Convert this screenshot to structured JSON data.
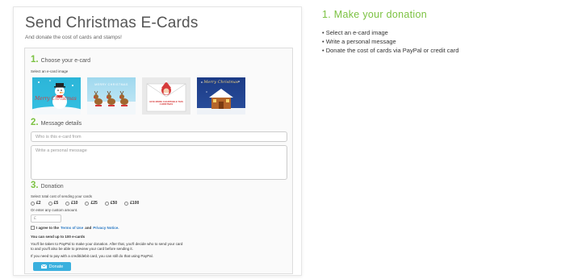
{
  "panel": {
    "title": "Send Christmas E-Cards",
    "subtitle": "And donate the cost of cards and stamps!"
  },
  "step1": {
    "number": "1.",
    "label": "Choose your e-card",
    "select_label": "Select an e-card image",
    "card_images": [
      {
        "name": "snowman-card",
        "text": "Merry Christmas"
      },
      {
        "name": "reindeer-card",
        "text": "MERRY CHRISTMAS"
      },
      {
        "name": "santa-envelope-card",
        "text": "GIVE MORE CHARITABLE THIS CHRISTMAS"
      },
      {
        "name": "gingerbread-house-card",
        "text": "Merry Christmas"
      }
    ]
  },
  "step2": {
    "number": "2.",
    "label": "Message details",
    "from_placeholder": "Who is this e-card from",
    "message_placeholder": "Write a personal message"
  },
  "step3": {
    "number": "3.",
    "label": "Donation",
    "select_label": "Select total cost of sending your cards",
    "amounts": [
      "£2",
      "£5",
      "£10",
      "£25",
      "£50",
      "£100"
    ],
    "custom_label": "Or enter any custom amount.",
    "custom_placeholder": "£",
    "agree_prefix": "I agree to the",
    "terms_link": "Terms of Use",
    "agree_and": "and",
    "privacy_link": "Privacy Notice."
  },
  "notes": {
    "limit": "You can send up to 100 e-cards",
    "paypal_line1": "You'll be taken to PayPal to make your donation. After that, you'll decide who to send your card",
    "paypal_line2": "to and you'll also be able to preview your card before sending it.",
    "card_note": "If you need to pay with a credit/debit card, you can still do that using PayPal."
  },
  "donate_button": {
    "label": "Donate",
    "icon": "envelope-icon",
    "color": "#3ab0de"
  },
  "side": {
    "title": "1. Make your donation",
    "items": [
      "Select an e-card image",
      "Write a personal message",
      "Donate the cost of cards via PayPal or credit card"
    ]
  },
  "colors": {
    "accent_green": "#7cc242",
    "link_blue": "#2a79c4"
  }
}
